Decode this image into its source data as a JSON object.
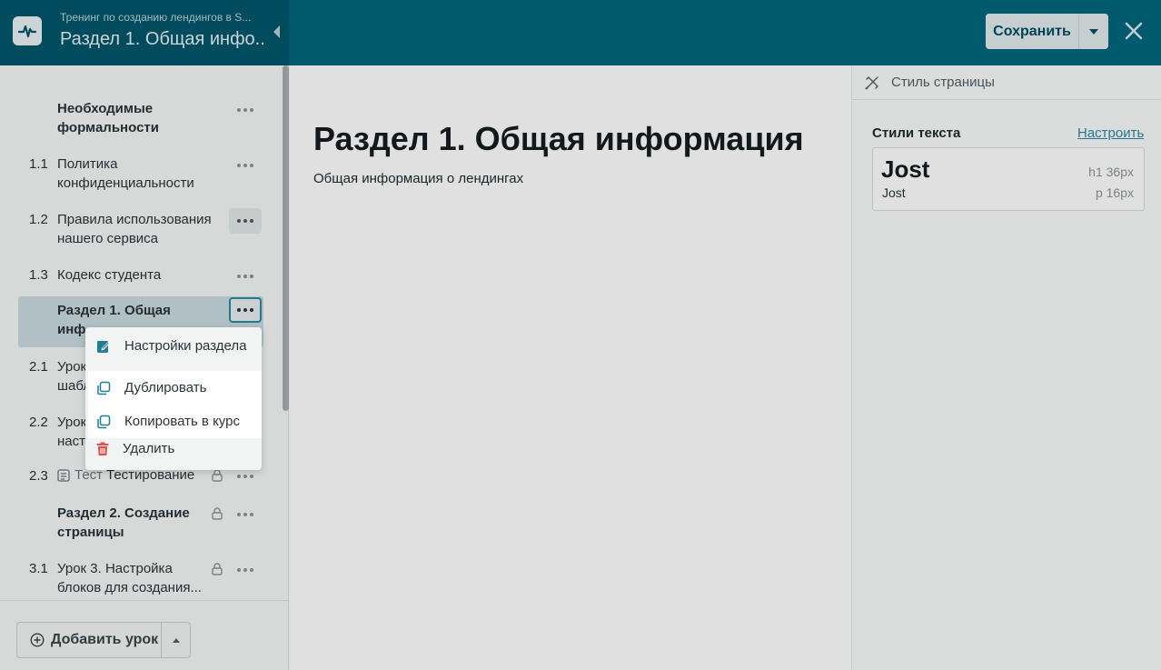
{
  "header": {
    "course_title": "Тренинг по созданию лендингов в S...",
    "section_title": "Раздел 1. Общая инфо...",
    "save_label": "Сохранить"
  },
  "sidebar": {
    "items": [
      {
        "num": "",
        "label": "Необходимые формальности",
        "bold": true
      },
      {
        "num": "1.1",
        "label": "Политика конфиденциальности"
      },
      {
        "num": "1.2",
        "label": "Правила использования нашего сервиса"
      },
      {
        "num": "1.3",
        "label": "Кодекс студента"
      },
      {
        "num": "",
        "label": "Раздел 1. Общая инф",
        "bold": true,
        "active": true
      },
      {
        "num": "2.1",
        "label": "Урок шабл"
      },
      {
        "num": "2.2",
        "label": "Урок наст"
      },
      {
        "num": "2.3",
        "label_prefix": "Тест",
        "label": "Тестирование",
        "locked": true
      },
      {
        "num": "",
        "label": "Раздел 2. Создание страницы",
        "bold": true,
        "locked": true
      },
      {
        "num": "3.1",
        "label": "Урок 3. Настройка блоков для создания...",
        "locked": true
      }
    ],
    "add_lesson_label": "Добавить урок"
  },
  "main": {
    "heading": "Раздел 1. Общая информация",
    "paragraph": "Общая информация о лендингах"
  },
  "right_panel": {
    "page_style_label": "Стиль страницы",
    "text_styles_title": "Стили текста",
    "configure_label": "Настроить",
    "font_big": "Jost",
    "font_small": "Jost",
    "h1_meta": "h1  36px",
    "p_meta": "p  16px"
  },
  "context_menu": {
    "items": [
      {
        "label": "Настройки раздела",
        "icon": "edit-icon",
        "color": "#1f7f99"
      },
      {
        "label": "Дублировать",
        "icon": "duplicate-icon",
        "color": "#1f7f99"
      },
      {
        "label": "Копировать в курс",
        "icon": "copy-icon",
        "color": "#1f7f99"
      },
      {
        "label": "Удалить",
        "icon": "trash-icon",
        "color": "#d9534f"
      }
    ]
  }
}
